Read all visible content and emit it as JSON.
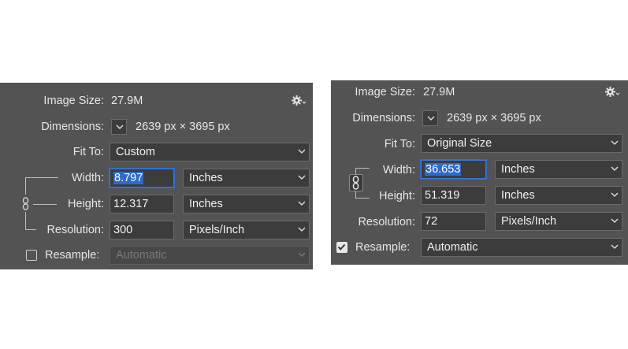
{
  "left": {
    "image_size_label": "Image Size:",
    "image_size_value": "27.9M",
    "dimensions_label": "Dimensions:",
    "dimensions_value": "2639 px  ×  3695 px",
    "fit_to_label": "Fit To:",
    "fit_to_value": "Custom",
    "width_label": "Width:",
    "width_value": "8.797",
    "width_unit": "Inches",
    "height_label": "Height:",
    "height_value": "12.317",
    "height_unit": "Inches",
    "resolution_label": "Resolution:",
    "resolution_value": "300",
    "resolution_unit": "Pixels/Inch",
    "resample_label": "Resample:",
    "resample_value": "Automatic",
    "resample_checked": false
  },
  "right": {
    "image_size_label": "Image Size:",
    "image_size_value": "27.9M",
    "dimensions_label": "Dimensions:",
    "dimensions_value": "2639 px  ×  3695 px",
    "fit_to_label": "Fit To:",
    "fit_to_value": "Original Size",
    "width_label": "Width:",
    "width_value": "36.653",
    "width_unit": "Inches",
    "height_label": "Height:",
    "height_value": "51.319",
    "height_unit": "Inches",
    "resolution_label": "Resolution:",
    "resolution_value": "72",
    "resolution_unit": "Pixels/Inch",
    "resample_label": "Resample:",
    "resample_value": "Automatic",
    "resample_checked": true
  },
  "icons": {
    "gear": "gear-icon",
    "chevron": "chevron-down-icon",
    "chain": "chain-link-icon",
    "check": "checkmark-icon"
  },
  "colors": {
    "panel_bg": "#535353",
    "field_bg": "#3c3c3c",
    "focus_blue": "#2f6ac6",
    "text": "#e6e6e6"
  }
}
